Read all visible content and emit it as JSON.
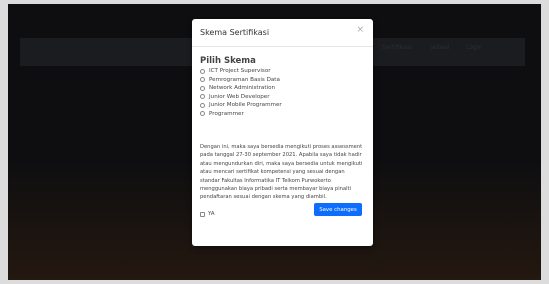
{
  "background": {
    "nav_items": [
      "Sertifikasi",
      "Jadwal",
      "Login"
    ]
  },
  "modal": {
    "title": "Skema Sertifikasi",
    "close_symbol": "×",
    "section_title": "Pilih Skema",
    "options": [
      {
        "label": "ICT Project Supervisor"
      },
      {
        "label": "Pemrograman Basis Data"
      },
      {
        "label": "Network Administration"
      },
      {
        "label": "Junior Web Developer"
      },
      {
        "label": "Junior Mobile Programmer"
      },
      {
        "label": "Programmer"
      }
    ],
    "statement_lines": [
      "Dengan ini, maka saya bersedia mengikuti proses assessment",
      "pada tanggal 27-30 september 2021. Apabila saya tidak hadir",
      "atau mengundurkan diri, maka saya bersedia untuk mengikuti",
      "atau mencari sertifikat kompetensi yang sesuai dengan",
      "standar Fakultas Informatika IT Telkom Purwokerto",
      "menggunakan biaya pribadi serta membayar biaya pinalti",
      "pendaftaran sesuai dengan skema yang diambil."
    ],
    "agree_label": "YA",
    "save_label": "Save changes"
  },
  "colors": {
    "primary": "#0d6efd",
    "overlay": "#0e0e10"
  }
}
